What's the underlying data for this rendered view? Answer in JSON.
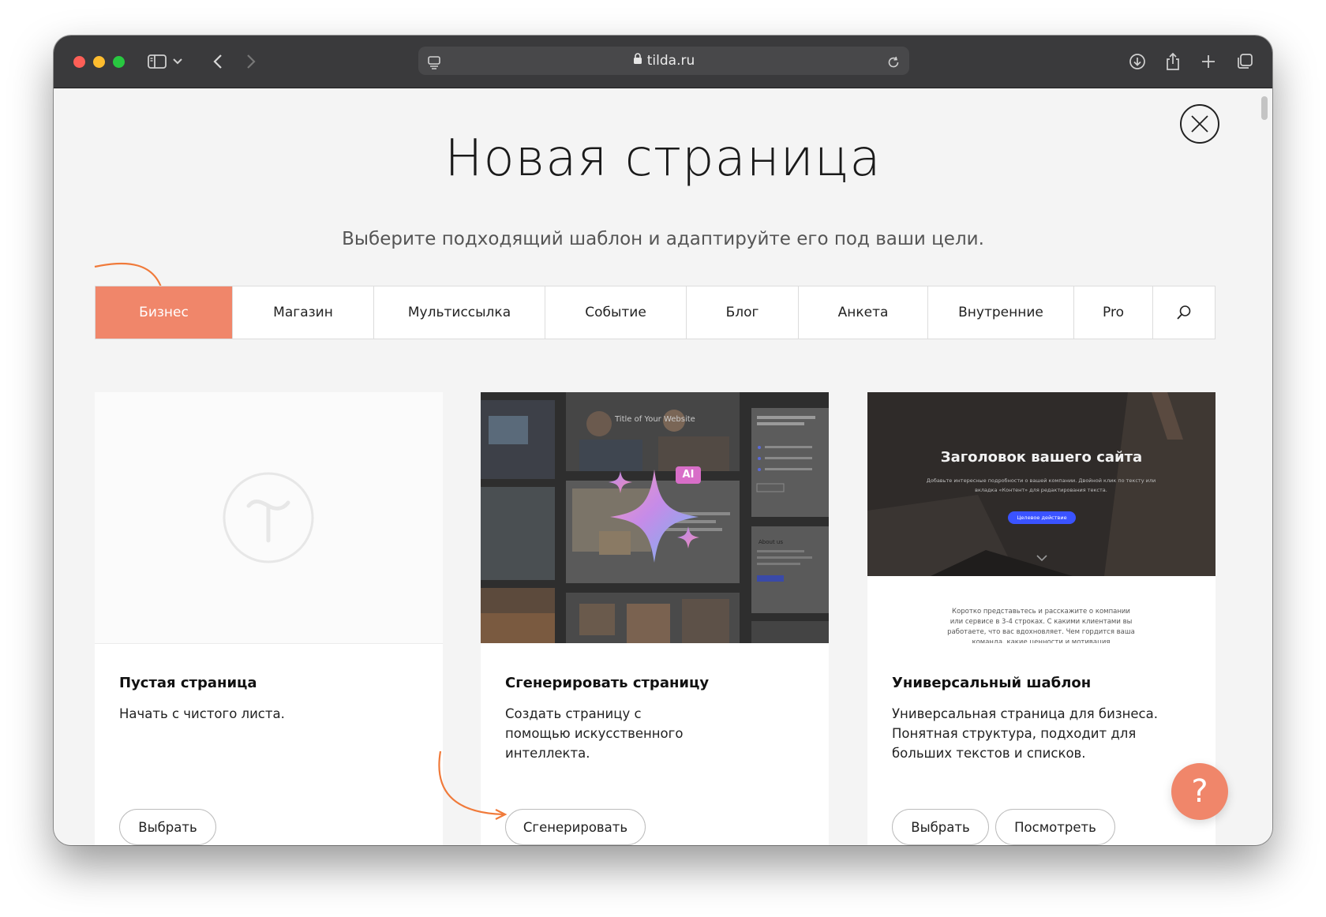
{
  "browser": {
    "url": "tilda.ru"
  },
  "page": {
    "title": "Новая страница",
    "subtitle": "Выберите подходящий шаблон и адаптируйте его под ваши цели."
  },
  "tabs": [
    {
      "label": "Бизнес",
      "active": true
    },
    {
      "label": "Магазин",
      "active": false
    },
    {
      "label": "Мультиссылка",
      "active": false
    },
    {
      "label": "Событие",
      "active": false
    },
    {
      "label": "Блог",
      "active": false
    },
    {
      "label": "Анкета",
      "active": false
    },
    {
      "label": "Внутренние",
      "active": false
    },
    {
      "label": "Pro",
      "active": false
    }
  ],
  "cards": [
    {
      "title": "Пустая страница",
      "description": "Начать с чистого листа.",
      "buttons": [
        "Выбрать"
      ]
    },
    {
      "title": "Сгенерировать страницу",
      "description": "Создать страницу с помощью искусственного интеллекта.",
      "buttons": [
        "Сгенерировать"
      ],
      "preview": {
        "badge": "AI",
        "site_title": "Title of Your Website",
        "about": "About us"
      }
    },
    {
      "title": "Универсальный шаблон",
      "description": "Универсальная страница для бизнеса. Понятная структура, подходит для больших текстов и списков.",
      "buttons": [
        "Выбрать",
        "Посмотреть"
      ],
      "preview": {
        "heading": "Заголовок вашего сайта",
        "subheading": "Добавьте интересные подробности о вашей компании. Двойной клик по тексту или вкладка «Контент» для редактирования текста.",
        "cta": "Целевое действие",
        "body": "Коротко представьтесь и расскажите о компании или сервисе в 3-4 строках. С какими клиентами вы работаете, что вас вдохновляет. Чем гордится ваша команда, какие ценности и мотивация"
      }
    }
  ],
  "help_button": "?",
  "colors": {
    "accent": "#f0866a",
    "arrow": "#f07a3a",
    "titlebar": "#3a3a3c"
  }
}
